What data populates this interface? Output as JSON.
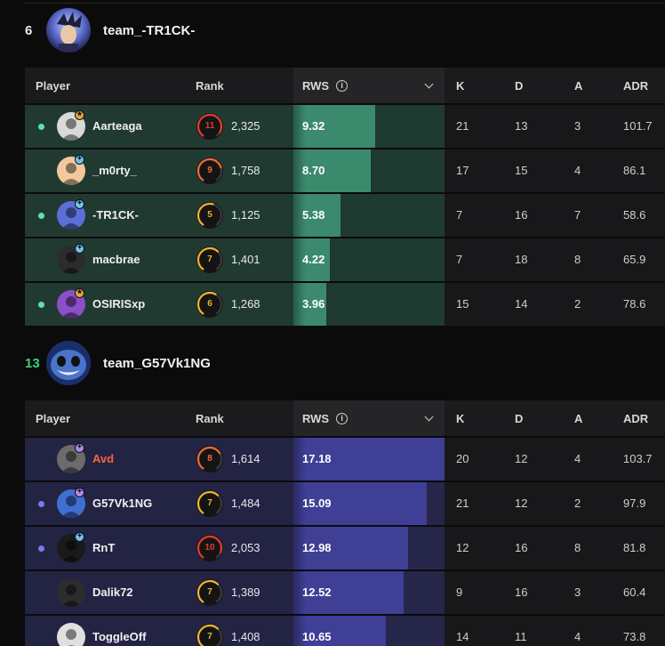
{
  "header_labels": {
    "player": "Player",
    "rank": "Rank",
    "rws": "RWS",
    "info_glyph": "i",
    "k": "K",
    "d": "D",
    "a": "A",
    "adr": "ADR"
  },
  "teams": [
    {
      "score": "6",
      "name": "team_-TR1CK-",
      "theme": "A",
      "players": [
        {
          "name": "Aarteaga",
          "dot": true,
          "badge": "gold",
          "level": "11",
          "level_frac": 0.92,
          "level_color": "#e8392a",
          "elo": "2,325",
          "rws": "9.32",
          "rws_frac": 0.54,
          "k": "21",
          "d": "13",
          "a": "3",
          "adr": "101.7"
        },
        {
          "name": "_m0rty_",
          "dot": false,
          "badge": "blue",
          "level": "9",
          "level_frac": 0.75,
          "level_color": "#f2683a",
          "elo": "1,758",
          "rws": "8.70",
          "rws_frac": 0.51,
          "k": "17",
          "d": "15",
          "a": "4",
          "adr": "86.1"
        },
        {
          "name": "-TR1CK-",
          "dot": true,
          "badge": "blue",
          "level": "5",
          "level_frac": 0.55,
          "level_color": "#f1b22e",
          "elo": "1,125",
          "rws": "5.38",
          "rws_frac": 0.31,
          "k": "7",
          "d": "16",
          "a": "7",
          "adr": "58.6"
        },
        {
          "name": "macbrae",
          "dot": false,
          "badge": "blue",
          "level": "7",
          "level_frac": 0.65,
          "level_color": "#f1b22e",
          "elo": "1,401",
          "rws": "4.22",
          "rws_frac": 0.24,
          "k": "7",
          "d": "18",
          "a": "8",
          "adr": "65.9"
        },
        {
          "name": "OSIRISxp",
          "dot": true,
          "badge": "gold",
          "level": "6",
          "level_frac": 0.6,
          "level_color": "#f1b22e",
          "elo": "1,268",
          "rws": "3.96",
          "rws_frac": 0.22,
          "k": "15",
          "d": "14",
          "a": "2",
          "adr": "78.6"
        }
      ]
    },
    {
      "score": "13",
      "name": "team_G57Vk1NG",
      "theme": "B",
      "players": [
        {
          "name": "Avd",
          "dot": false,
          "badge": "purple",
          "name_color": "orange",
          "level": "8",
          "level_frac": 0.7,
          "level_color": "#f2683a",
          "elo": "1,614",
          "rws": "17.18",
          "rws_frac": 1.0,
          "k": "20",
          "d": "12",
          "a": "4",
          "adr": "103.7"
        },
        {
          "name": "G57Vk1NG",
          "dot": true,
          "badge": "purple",
          "level": "7",
          "level_frac": 0.65,
          "level_color": "#f1b22e",
          "elo": "1,484",
          "rws": "15.09",
          "rws_frac": 0.88,
          "k": "21",
          "d": "12",
          "a": "2",
          "adr": "97.9"
        },
        {
          "name": "RnT",
          "dot": true,
          "badge": "blue",
          "level": "10",
          "level_frac": 0.88,
          "level_color": "#e8392a",
          "elo": "2,053",
          "rws": "12.98",
          "rws_frac": 0.76,
          "k": "12",
          "d": "16",
          "a": "8",
          "adr": "81.8"
        },
        {
          "name": "Dalik72",
          "dot": false,
          "badge": "none",
          "level": "7",
          "level_frac": 0.65,
          "level_color": "#f1b22e",
          "elo": "1,389",
          "rws": "12.52",
          "rws_frac": 0.73,
          "k": "9",
          "d": "16",
          "a": "3",
          "adr": "60.4"
        },
        {
          "name": "ToggleOff",
          "dot": false,
          "badge": "none",
          "level": "7",
          "level_frac": 0.65,
          "level_color": "#f1b22e",
          "elo": "1,408",
          "rws": "10.65",
          "rws_frac": 0.61,
          "k": "14",
          "d": "11",
          "a": "4",
          "adr": "73.8"
        }
      ]
    }
  ]
}
